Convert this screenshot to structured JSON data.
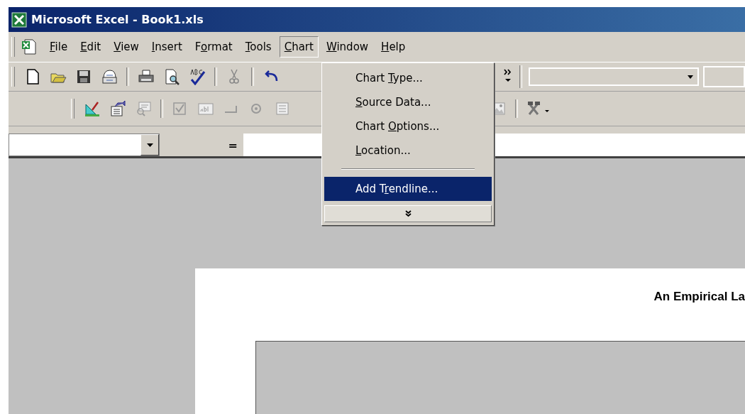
{
  "window": {
    "title": "Microsoft Excel - Book1.xls"
  },
  "menu_bar": [
    {
      "label_parts": [
        {
          "text": "F",
          "underlined": true
        },
        {
          "text": "ile",
          "underlined": false
        }
      ],
      "selected": false
    },
    {
      "label_parts": [
        {
          "text": "E",
          "underlined": true
        },
        {
          "text": "dit",
          "underlined": false
        }
      ],
      "selected": false
    },
    {
      "label_parts": [
        {
          "text": "V",
          "underlined": true
        },
        {
          "text": "iew",
          "underlined": false
        }
      ],
      "selected": false
    },
    {
      "label_parts": [
        {
          "text": "I",
          "underlined": true
        },
        {
          "text": "nsert",
          "underlined": false
        }
      ],
      "selected": false
    },
    {
      "label_parts": [
        {
          "text": "F",
          "underlined": false
        },
        {
          "text": "o",
          "underlined": true
        },
        {
          "text": "rmat",
          "underlined": false
        }
      ],
      "selected": false
    },
    {
      "label_parts": [
        {
          "text": "T",
          "underlined": true
        },
        {
          "text": "ools",
          "underlined": false
        }
      ],
      "selected": false
    },
    {
      "label_parts": [
        {
          "text": "C",
          "underlined": true
        },
        {
          "text": "hart",
          "underlined": false
        }
      ],
      "selected": true
    },
    {
      "label_parts": [
        {
          "text": "W",
          "underlined": true
        },
        {
          "text": "indow",
          "underlined": false
        }
      ],
      "selected": false
    },
    {
      "label_parts": [
        {
          "text": "H",
          "underlined": true
        },
        {
          "text": "elp",
          "underlined": false
        }
      ],
      "selected": false
    }
  ],
  "chart_menu": [
    {
      "kind": "item",
      "label_parts": [
        {
          "text": "Chart ",
          "underlined": false
        },
        {
          "text": "T",
          "underlined": true
        },
        {
          "text": "ype...",
          "underlined": false
        }
      ],
      "selected": false
    },
    {
      "kind": "item",
      "label_parts": [
        {
          "text": "S",
          "underlined": true
        },
        {
          "text": "ource Data...",
          "underlined": false
        }
      ],
      "selected": false
    },
    {
      "kind": "item",
      "label_parts": [
        {
          "text": "Chart ",
          "underlined": false
        },
        {
          "text": "O",
          "underlined": true
        },
        {
          "text": "ptions...",
          "underlined": false
        }
      ],
      "selected": false
    },
    {
      "kind": "item",
      "label_parts": [
        {
          "text": "L",
          "underlined": true
        },
        {
          "text": "ocation...",
          "underlined": false
        }
      ],
      "selected": false
    },
    {
      "kind": "separator"
    },
    {
      "kind": "item",
      "label_parts": [
        {
          "text": "Add T",
          "underlined": false
        },
        {
          "text": "r",
          "underlined": true
        },
        {
          "text": "endline...",
          "underlined": false
        }
      ],
      "selected": true
    },
    {
      "kind": "expand"
    }
  ],
  "formula_bar": {
    "equals": "="
  },
  "chart_sheet": {
    "title": "An Empirical La"
  }
}
